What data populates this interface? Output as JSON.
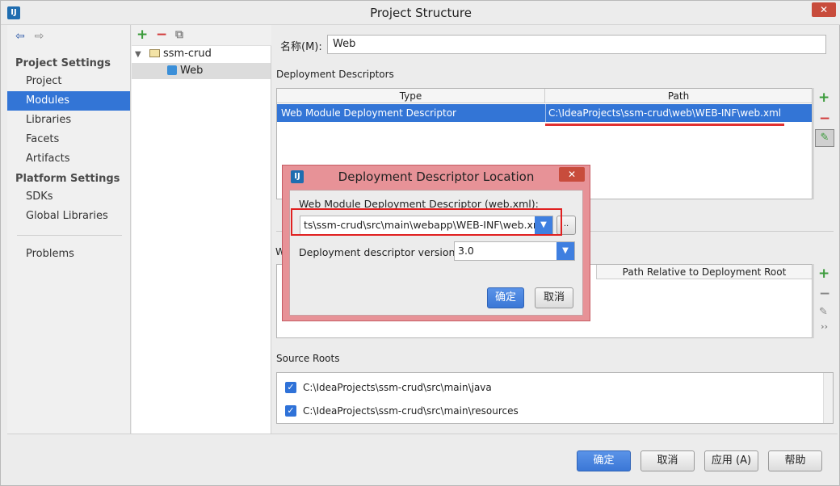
{
  "window": {
    "title": "Project Structure",
    "close": "✕"
  },
  "left": {
    "project_settings": "Project Settings",
    "items1": [
      {
        "label": "Project"
      },
      {
        "label": "Modules"
      },
      {
        "label": "Libraries"
      },
      {
        "label": "Facets"
      },
      {
        "label": "Artifacts"
      }
    ],
    "platform_settings": "Platform Settings",
    "items2": [
      {
        "label": "SDKs"
      },
      {
        "label": "Global Libraries"
      }
    ],
    "problems": "Problems"
  },
  "tree": {
    "root": "ssm-crud",
    "child": "Web"
  },
  "right": {
    "name_label": "名称(M):",
    "name_value": "Web",
    "deployment_descriptors": "Deployment Descriptors",
    "col_type": "Type",
    "col_path": "Path",
    "row_type": "Web Module Deployment Descriptor",
    "row_path": "C:\\IdeaProjects\\ssm-crud\\web\\WEB-INF\\web.xml",
    "web_res_col": "Path Relative to Deployment Root",
    "web_res_prefix": "W",
    "source_roots": "Source Roots",
    "sources": [
      "C:\\IdeaProjects\\ssm-crud\\src\\main\\java",
      "C:\\IdeaProjects\\ssm-crud\\src\\main\\resources"
    ]
  },
  "dialog": {
    "title": "Deployment Descriptor Location",
    "close": "✕",
    "label": "Web Module Deployment Descriptor (web.xml):",
    "path_value": "ts\\ssm-crud\\src\\main\\webapp\\WEB-INF\\web.xml",
    "browse": "..",
    "version_label": "Deployment descriptor version",
    "version_value": "3.0",
    "ok": "确定",
    "cancel": "取消"
  },
  "footer": {
    "ok": "确定",
    "cancel": "取消",
    "apply": "应用 (A)",
    "help": "帮助"
  },
  "icons": [
    "back-icon",
    "forward-icon",
    "add-icon",
    "remove-icon",
    "copy-icon",
    "edit-icon",
    "folder-icon",
    "module-icon",
    "more-icon"
  ],
  "colors": {
    "accent": "#3375d6",
    "dialog_border": "#e79297",
    "highlight": "#e02020"
  }
}
